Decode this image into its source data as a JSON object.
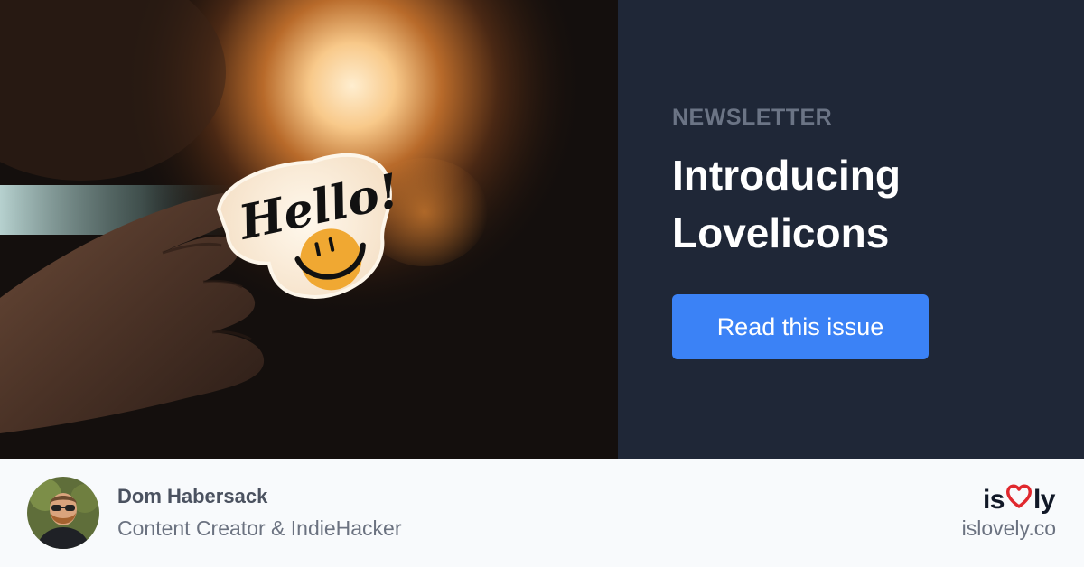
{
  "hero": {
    "image_alt": "Hand holding a Hello! sticker in front of a warm light",
    "sticker_text": "Hello!",
    "category": "NEWSLETTER",
    "title": "Introducing Lovelicons",
    "cta_label": "Read this issue"
  },
  "author": {
    "name": "Dom Habersack",
    "role": "Content Creator & IndieHacker",
    "avatar_icon": "person-avatar"
  },
  "brand": {
    "logo_prefix": "is",
    "logo_icon": "heart-outline-icon",
    "logo_suffix": "ly",
    "domain": "islovely.co"
  },
  "colors": {
    "panel_bg": "#1f2737",
    "eyebrow": "#6b7485",
    "button": "#3b82f6",
    "heart": "#e0282e",
    "footer_bg": "#f8fafc"
  }
}
